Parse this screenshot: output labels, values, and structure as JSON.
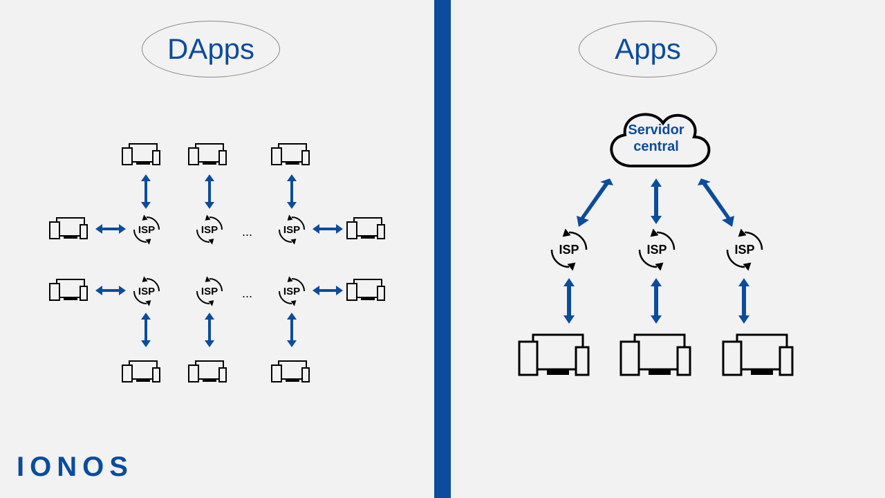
{
  "left": {
    "title": "DApps",
    "isp_label": "ISP",
    "ellipsis": "..."
  },
  "right": {
    "title": "Apps",
    "cloud_label": "Servidor\ncentral",
    "isp_label": "ISP"
  },
  "logo": "IONOS",
  "colors": {
    "brand": "#0b4c9c"
  }
}
